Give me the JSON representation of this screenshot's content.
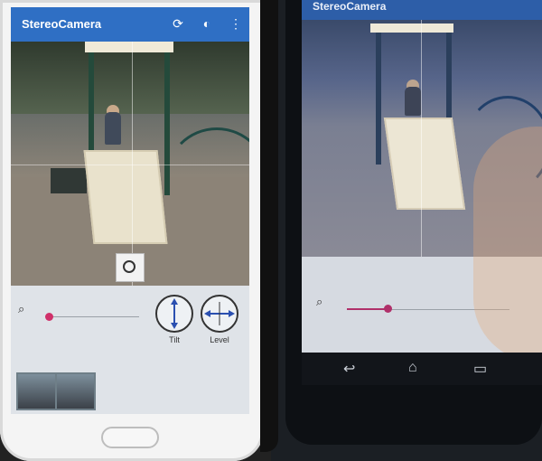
{
  "left_phone": {
    "app_title": "StereoCamera",
    "toolbar_icons": [
      "sync-icon",
      "contrast-icon",
      "more-vert-icon"
    ],
    "zoom_icon": "search-icon",
    "zoom_level": 0.0,
    "tilt_label": "Tilt",
    "level_label": "Level",
    "accent_color": "#d0306a",
    "appbar_color": "#2f6fc4"
  },
  "right_phone": {
    "app_title": "StereoCamera",
    "zoom_icon": "search-icon",
    "zoom_level": 0.25,
    "nav_icons": [
      "back-icon",
      "home-icon",
      "recents-icon"
    ]
  }
}
